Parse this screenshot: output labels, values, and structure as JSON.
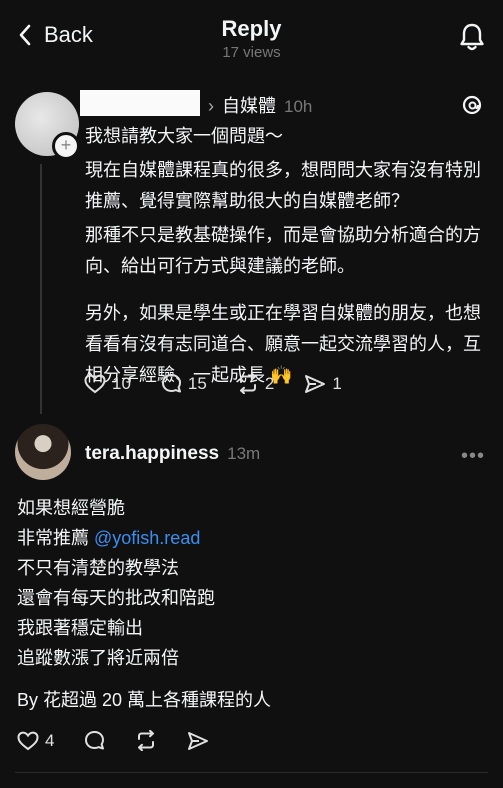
{
  "header": {
    "back_label": "Back",
    "title": "Reply",
    "views": "17 views"
  },
  "post": {
    "community": "自媒體",
    "time": "10h",
    "paragraphs": [
      "我想請教大家一個問題～",
      "現在自媒體課程真的很多，想問問大家有沒有特別推薦、覺得實際幫助很大的自媒體老師？",
      "那種不只是教基礎操作，而是會協助分析適合的方向、給出可行方式與建議的老師。",
      "另外，如果是學生或正在學習自媒體的朋友，也想看看有沒有志同道合、願意一起交流學習的人，互相分享經驗、一起成長 🙌"
    ],
    "likes": "10",
    "comments": "15",
    "reposts": "2",
    "shares": "1"
  },
  "reply": {
    "username": "tera.happiness",
    "time": "13m",
    "lines": [
      "如果想經營脆",
      "非常推薦",
      "不只有清楚的教學法",
      "還會有每天的批改和陪跑",
      "我跟著穩定輸出",
      "追蹤數漲了將近兩倍"
    ],
    "mention": "@yofish.read",
    "extra": "By 花超過 20 萬上各種課程的人",
    "likes": "4"
  },
  "icons": [
    "chevron-left-icon",
    "bell-icon",
    "threads-logo-icon",
    "heart-icon",
    "comment-icon",
    "repost-icon",
    "share-icon",
    "more-icon"
  ]
}
